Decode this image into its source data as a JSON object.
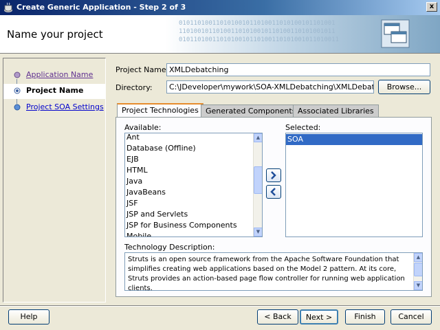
{
  "window": {
    "title": "Create Generic Application - Step 2 of 3",
    "close_label": "x"
  },
  "header": {
    "page_title": "Name your project",
    "binary_lines": [
      "010110100110101001011010011010100101101001",
      "110100101101001101010010110100110101001011",
      "0101101001101010010110100110101001011010011"
    ]
  },
  "nav": {
    "items": [
      {
        "label": "Application Name",
        "state": "visited"
      },
      {
        "label": "Project Name",
        "state": "current"
      },
      {
        "label": "Project SOA Settings",
        "state": "link"
      }
    ]
  },
  "form": {
    "project_name_label": "Project Name:",
    "project_name_value": "XMLDebatching",
    "directory_label": "Directory:",
    "directory_value": "C:\\JDeveloper\\mywork\\SOA-XMLDebatching\\XMLDebatching",
    "browse_button": "Browse..."
  },
  "tabs": [
    {
      "label": "Project Technologies",
      "active": true
    },
    {
      "label": "Generated Components",
      "active": false
    },
    {
      "label": "Associated Libraries",
      "active": false
    }
  ],
  "technologies": {
    "available_label": "Available:",
    "available": [
      "Ant",
      "Database (Offline)",
      "EJB",
      "HTML",
      "Java",
      "JavaBeans",
      "JSF",
      "JSP and Servlets",
      "JSP for Business Components",
      "Mobile"
    ],
    "selected_label": "Selected:",
    "selected": [
      "SOA"
    ],
    "add_icon": "chevron-right-icon",
    "remove_icon": "chevron-left-icon",
    "description_label": "Technology Description:",
    "description": "Struts is an open source framework from the Apache Software Foundation that simplifies creating web applications based on the Model 2 pattern. At its core, Struts provides an action-based page flow controller for running web application clients."
  },
  "footer": {
    "help": "Help",
    "back": "< Back",
    "next": "Next >",
    "finish": "Finish",
    "cancel": "Cancel"
  },
  "colors": {
    "title_bar": "#0a246a",
    "selection": "#316ac5",
    "active_tab_accent": "#e68b2c"
  }
}
